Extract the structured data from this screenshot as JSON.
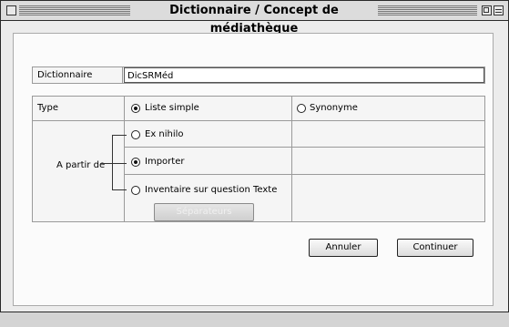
{
  "window": {
    "title": "Dictionnaire / Concept de médiathèque"
  },
  "dictionary": {
    "label": "Dictionnaire",
    "value": "DicSRMéd"
  },
  "type_row": {
    "label": "Type",
    "options": [
      {
        "label": "Liste simple",
        "selected": true
      },
      {
        "label": "Synonyme",
        "selected": false
      }
    ]
  },
  "source": {
    "label": "A partir de",
    "options": [
      {
        "label": "Ex nihilo",
        "selected": false
      },
      {
        "label": "Importer",
        "selected": true
      },
      {
        "label": "Inventaire sur question Texte",
        "selected": false
      }
    ],
    "separators_button": "Séparateurs"
  },
  "buttons": {
    "cancel": "Annuler",
    "continue": "Continuer"
  }
}
